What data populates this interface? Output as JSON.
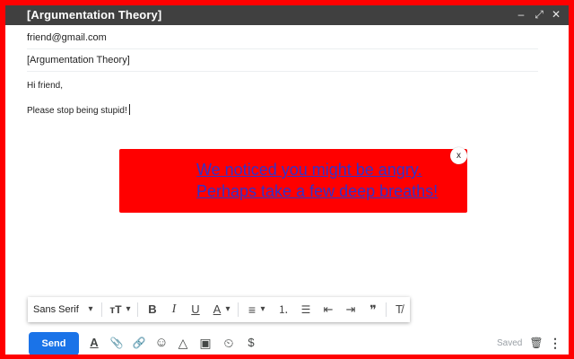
{
  "window": {
    "title": "[Argumentation Theory]",
    "controls": {
      "minimize": "–",
      "popout": "⤢",
      "close": "✕"
    }
  },
  "compose": {
    "to": "friend@gmail.com",
    "subject": "[Argumentation Theory]",
    "body_lines": [
      "Hi friend,",
      "Please stop being stupid!"
    ]
  },
  "alert": {
    "line1": "We noticed you might be angry.",
    "line2": "Perhaps take a few deep breaths!",
    "close_label": "x",
    "background_color": "#ff0000",
    "text_color": "#3232c8"
  },
  "format_bar": {
    "font": "Sans Serif",
    "dropdown_glyph": "▾",
    "size_glyph": "ᴛT",
    "bold": "B",
    "italic": "I",
    "underline": "U",
    "text_color": "A",
    "align": "≡",
    "numbered_list": "⒈",
    "bulleted_list": "☰",
    "indent_less": "⇤",
    "indent_more": "⇥",
    "quote": "❞",
    "clear_format": "T̸"
  },
  "bottom_bar": {
    "send_label": "Send",
    "format_icon": "A",
    "attach_icon": "📎",
    "link_icon": "🔗",
    "emoji_icon": "☺",
    "drive_icon": "△",
    "photo_icon": "▣",
    "schedule_icon": "⏲",
    "money_icon": "$",
    "saved_label": "Saved",
    "trash_icon": "🗑",
    "more_icon": "⋮"
  },
  "colors": {
    "frame": "#ff0000",
    "titlebar": "#404040",
    "send_button": "#1a73e8"
  }
}
